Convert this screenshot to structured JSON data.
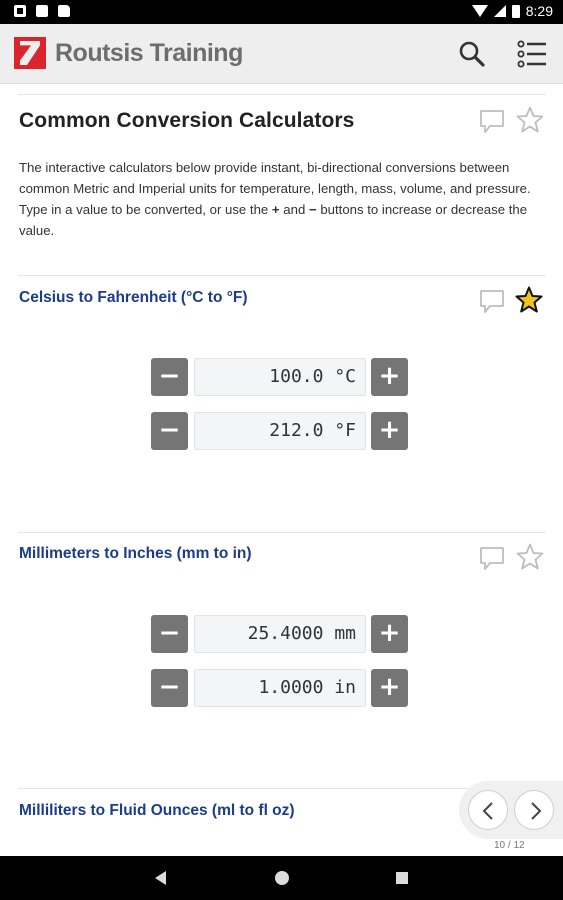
{
  "status_bar": {
    "time": "8:29"
  },
  "app_bar": {
    "brand": "Routsis Training"
  },
  "page": {
    "title": "Common Conversion Calculators",
    "desc_part1": "The interactive calculators below provide instant, bi-directional conversions between common Metric and Imperial units for temperature, length, mass, volume, and pressure. Type in a value to be converted, or use the ",
    "plus_sym": "+",
    "and_text": " and ",
    "minus_sym": "−",
    "desc_part2": " buttons to increase or decrease the value."
  },
  "calculators": [
    {
      "title": "Celsius to Fahrenheit (°C to °F)",
      "starred": true,
      "fields": [
        "100.0 °C",
        "212.0 °F"
      ]
    },
    {
      "title": "Millimeters to Inches (mm to in)",
      "starred": false,
      "fields": [
        "25.4000 mm",
        "1.0000 in"
      ]
    },
    {
      "title": "Milliliters to Fluid Ounces (ml to fl oz)"
    }
  ],
  "stepper": {
    "minus": "−",
    "plus": "+"
  },
  "pager": {
    "count": "10 / 12"
  },
  "icons": {
    "search": "search-icon",
    "menu": "list-menu-icon",
    "comment": "comment-icon",
    "star": "star-icon",
    "prev": "chevron-left-icon",
    "next": "chevron-right-icon"
  },
  "colors": {
    "accent": "#1b3c8a",
    "logo": "#d9262c",
    "star_fill": "#f2c31d",
    "stepper": "#757575"
  }
}
